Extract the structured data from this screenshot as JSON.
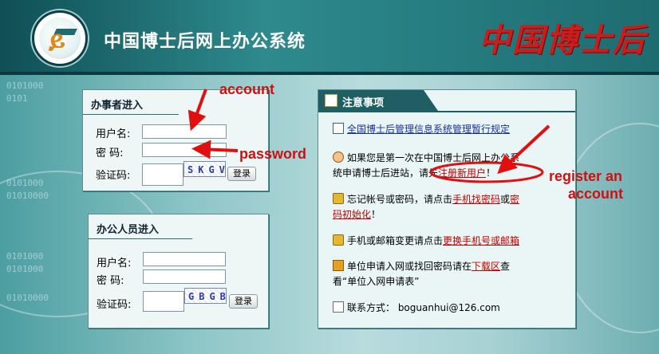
{
  "header": {
    "site_title": "中国博士后网上办公系统",
    "calligraphy_title": "中国博士后"
  },
  "login_staff": {
    "title": "办事者进入",
    "username_label": "用户名:",
    "password_label": "密  码:",
    "captcha_label": "验证码:",
    "captcha_text": "SKGV",
    "login_button": "登录"
  },
  "login_office": {
    "title": "办公人员进入",
    "username_label": "用户名:",
    "password_label": "密  码:",
    "captcha_label": "验证码:",
    "captcha_text": "GBGB",
    "login_button": "登录"
  },
  "notice": {
    "title": "注意事项",
    "item1_link": "全国博士后管理信息系统管理暂行规定",
    "item2_text_a": "如果您是第一次在中国博士后网上办公系",
    "item2_text_b": "统申请博士后进站，请先",
    "item2_link": "注册新用户",
    "item2_text_c": "！",
    "item3_text_a": "忘记帐号或密码，请点击",
    "item3_link1": "手机找密码",
    "item3_or": "或",
    "item3_link2a": "密",
    "item3_link2b": "码初始化",
    "item3_end": "！",
    "item4_text": "手机或邮箱变更请点击",
    "item4_link": "更换手机号或邮箱",
    "item5_text_a": "单位申请入网或找回密码请在",
    "item5_link": "下载区",
    "item5_text_b": "查",
    "item5_text_c": "看“单位入网申请表”",
    "item6_text": "联系方式：  boguanhui@126.com"
  },
  "annotations": {
    "account": "account",
    "password": "password",
    "register_line1": "register an",
    "register_line2": "account",
    "color": "#e01010"
  },
  "background_binary": [
    "0101000",
    "0101",
    "0101000",
    "01010000",
    "0101000",
    "0101000",
    "01010000"
  ]
}
